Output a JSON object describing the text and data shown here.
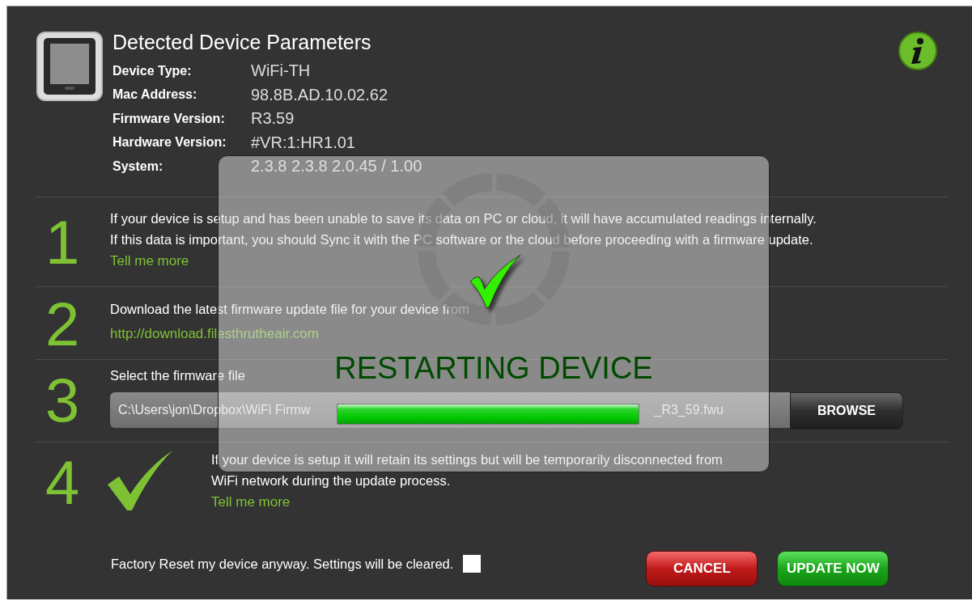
{
  "header": {
    "title": "Detected Device Parameters",
    "params": [
      {
        "label": "Device Type:",
        "value": "WiFi-TH"
      },
      {
        "label": "Mac Address:",
        "value": "98.8B.AD.10.02.62"
      },
      {
        "label": "Firmware Version:",
        "value": "R3.59"
      },
      {
        "label": "Hardware Version:",
        "value": "#VR:1:HR1.01"
      },
      {
        "label": "System:",
        "value": "2.3.8 2.3.8 2.0.45 / 1.00"
      }
    ]
  },
  "steps": [
    {
      "number": "1",
      "kind": "note",
      "lines": [
        "If your device is setup and has been unable to save its data on PC or cloud, it will have accumulated readings internally.",
        "If this data is important, you should Sync it with the PC software or the cloud before proceeding with a firmware update."
      ],
      "link": "Tell me more"
    },
    {
      "number": "2",
      "kind": "download",
      "lines": [
        "Download the latest firmware update file for your device from"
      ],
      "link": "http://download.filesthrutheair.com"
    },
    {
      "number": "3",
      "kind": "file",
      "lines": [
        "Select the firmware file"
      ],
      "file_start": "C:\\Users\\jon\\Dropbox\\WiFi Firmw",
      "file_end": "_R3_59.fwu",
      "button": "BROWSE"
    },
    {
      "number": "4",
      "kind": "confirm",
      "confirmed": true,
      "lines": [
        "If your device is setup it will retain its settings but will be temporarily disconnected from",
        "WiFi network during the update process."
      ],
      "link": "Tell me more"
    }
  ],
  "factory_reset": {
    "label": "Factory Reset my device anyway. Settings will be cleared.",
    "checked": false
  },
  "buttons": [
    {
      "label": "CANCEL",
      "kind": "cancel"
    },
    {
      "label": "UPDATE NOW",
      "kind": "confirm"
    }
  ],
  "overlay": {
    "message": "RESTARTING DEVICE",
    "done": true,
    "level": 1
  }
}
